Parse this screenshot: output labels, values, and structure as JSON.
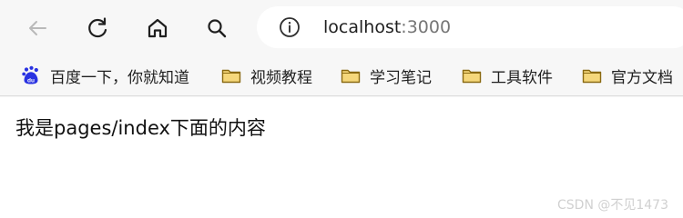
{
  "toolbar": {
    "back_icon": "back-arrow-icon",
    "reload_icon": "reload-icon",
    "home_icon": "home-icon",
    "search_icon": "search-icon"
  },
  "address_bar": {
    "info_icon": "info-circle-icon",
    "host": "localhost",
    "port": ":3000"
  },
  "bookmarks": [
    {
      "label": "百度一下，你就知道",
      "icon": "baidu-paw-icon"
    },
    {
      "label": "视频教程",
      "icon": "folder-icon"
    },
    {
      "label": "学习笔记",
      "icon": "folder-icon"
    },
    {
      "label": "工具软件",
      "icon": "folder-icon"
    },
    {
      "label": "官方文档",
      "icon": "folder-icon"
    }
  ],
  "page": {
    "content_text": "我是pages/index下面的内容"
  },
  "watermark": {
    "text": "CSDN @不见1473"
  },
  "colors": {
    "toolbar_bg": "#f7f7f7",
    "page_bg": "#ffffff",
    "folder_fill": "#f5d77b",
    "folder_stroke": "#8a6a12",
    "baidu_blue": "#2932e1"
  }
}
